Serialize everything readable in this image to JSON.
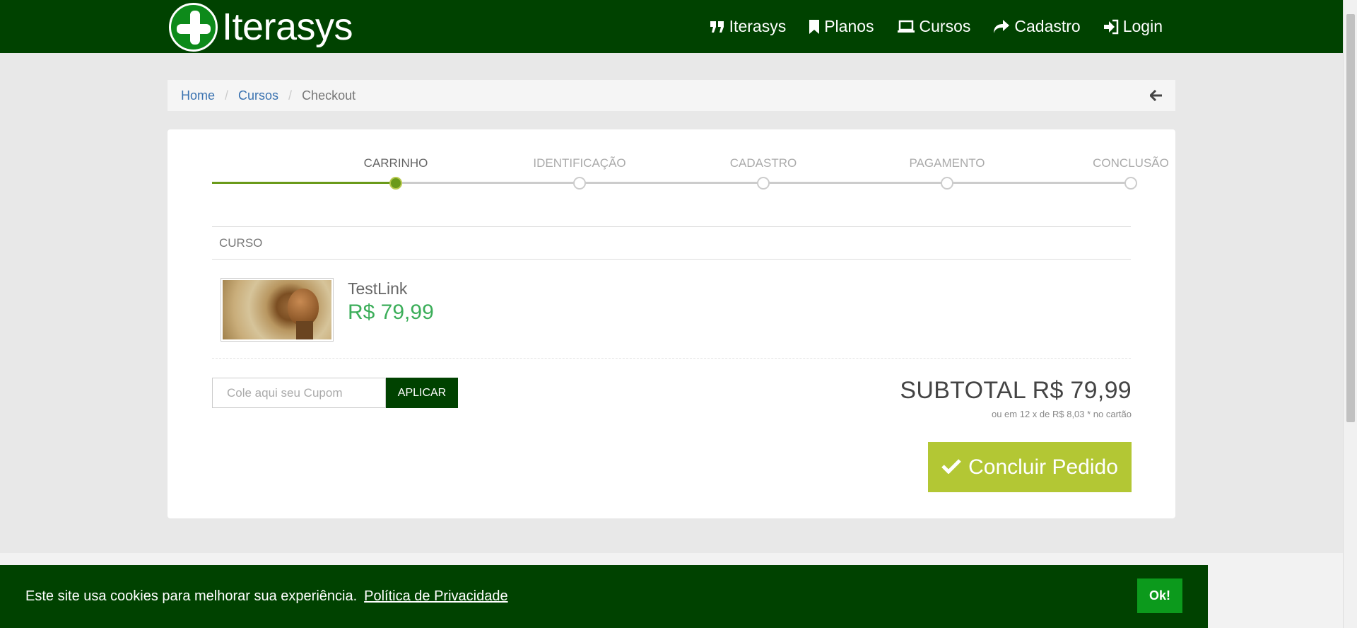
{
  "header": {
    "logo_text": "Iterasys",
    "nav": [
      {
        "label": "Iterasys",
        "icon": "quote-icon"
      },
      {
        "label": "Planos",
        "icon": "bookmark-icon"
      },
      {
        "label": "Cursos",
        "icon": "laptop-icon"
      },
      {
        "label": "Cadastro",
        "icon": "share-icon"
      },
      {
        "label": "Login",
        "icon": "sign-in-icon"
      }
    ]
  },
  "breadcrumb": {
    "home": "Home",
    "cursos": "Cursos",
    "current": "Checkout",
    "separator": "/"
  },
  "steps": [
    {
      "label": "CARRINHO",
      "active": true
    },
    {
      "label": "IDENTIFICAÇÃO",
      "active": false
    },
    {
      "label": "CADASTRO",
      "active": false
    },
    {
      "label": "PAGAMENTO",
      "active": false
    },
    {
      "label": "CONCLUSÃO",
      "active": false
    }
  ],
  "cart": {
    "column_header": "CURSO",
    "item": {
      "title": "TestLink",
      "price": "R$ 79,99"
    }
  },
  "coupon": {
    "placeholder": "Cole aqui seu Cupom",
    "button_label": "APLICAR"
  },
  "summary": {
    "subtotal": "SUBTOTAL R$ 79,99",
    "installments": "ou em 12 x de R$ 8,03 * no cartão",
    "checkout_label": "Concluir Pedido"
  },
  "cookie": {
    "message": "Este site usa cookies para melhorar sua experiência.",
    "policy_link": "Política de Privacidade",
    "ok_label": "Ok!"
  },
  "colors": {
    "header_bg": "#004200",
    "accent_green": "#b3c734",
    "price_green": "#3cae5a",
    "progress_green": "#6a9a1a"
  }
}
